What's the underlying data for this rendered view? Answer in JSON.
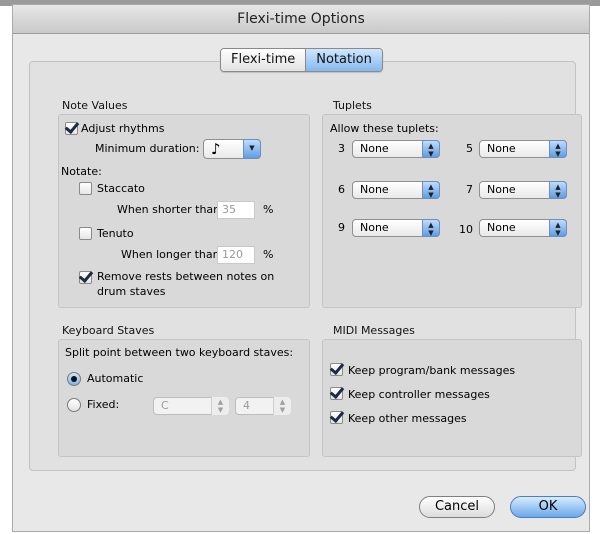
{
  "window": {
    "title": "Flexi-time Options"
  },
  "tabs": [
    {
      "label": "Flexi-time",
      "selected": false
    },
    {
      "label": "Notation",
      "selected": true
    }
  ],
  "note_values": {
    "title": "Note Values",
    "adjust_rhythms": {
      "label": "Adjust rhythms",
      "checked": true
    },
    "min_duration": {
      "label": "Minimum duration:",
      "value": "♪"
    },
    "notate_label": "Notate:",
    "staccato": {
      "label": "Staccato",
      "checked": false,
      "shorter_label": "When shorter than:",
      "value": "35",
      "unit": "%"
    },
    "tenuto": {
      "label": "Tenuto",
      "checked": false,
      "longer_label": "When longer than:",
      "value": "120",
      "unit": "%"
    },
    "remove_rests": {
      "label_line1": "Remove rests between notes on",
      "label_line2": "drum staves",
      "checked": true
    }
  },
  "tuplets": {
    "title": "Tuplets",
    "allow_label": "Allow these tuplets:",
    "items": [
      {
        "num": "3",
        "value": "None"
      },
      {
        "num": "5",
        "value": "None"
      },
      {
        "num": "6",
        "value": "None"
      },
      {
        "num": "7",
        "value": "None"
      },
      {
        "num": "9",
        "value": "None"
      },
      {
        "num": "10",
        "value": "None"
      }
    ]
  },
  "keyboard_staves": {
    "title": "Keyboard Staves",
    "split_label": "Split point between two keyboard staves:",
    "automatic": {
      "label": "Automatic",
      "selected": true
    },
    "fixed": {
      "label": "Fixed:",
      "selected": false,
      "note": "C",
      "octave": "4"
    }
  },
  "midi_messages": {
    "title": "MIDI Messages",
    "items": [
      {
        "label": "Keep program/bank messages",
        "checked": true
      },
      {
        "label": "Keep controller messages",
        "checked": true
      },
      {
        "label": "Keep other messages",
        "checked": true
      }
    ]
  },
  "buttons": {
    "cancel": "Cancel",
    "ok": "OK"
  },
  "colors": {
    "accent": "#6aa8ea",
    "window_bg": "#e8e8e8"
  },
  "icons": {
    "checkmark": "checkmark-icon",
    "stepper": "updown-arrows-icon",
    "dropdown": "dropdown-arrow-icon"
  }
}
